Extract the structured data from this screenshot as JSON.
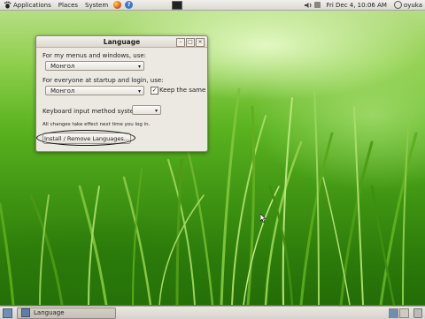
{
  "top_panel": {
    "menus": [
      "Applications",
      "Places",
      "System"
    ],
    "clock": "Fri Dec  4, 10:06 AM",
    "user": "oyuka"
  },
  "dialog": {
    "title": "Language",
    "menus_label": "For my menus and windows, use:",
    "menus_value": "Монгол",
    "startup_label": "For everyone at startup and login, use:",
    "startup_value": "Монгол",
    "keep_same_label": "Keep the same",
    "keep_same_checked": true,
    "input_method_label": "Keyboard input method system:",
    "input_method_value": "",
    "note": "All changes take effect next time you log in.",
    "install_button": "Install / Remove Languages..."
  },
  "bottom_panel": {
    "task_label": "Language"
  },
  "icons": [
    "gnome-foot-icon",
    "firefox-icon",
    "help-icon",
    "terminal-icon",
    "volume-icon",
    "network-icon",
    "power-icon",
    "show-desktop-icon",
    "trash-icon"
  ],
  "colors": {
    "panel": "#dcd8d2",
    "dialog_bg": "#ece8e2",
    "grass": "#5ab31f"
  }
}
